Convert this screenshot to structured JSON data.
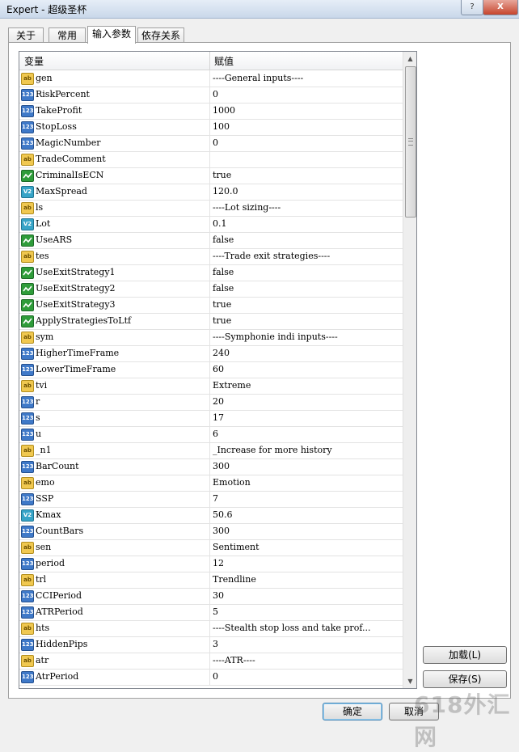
{
  "window": {
    "title": "Expert - 超级圣杯",
    "help_label": "?",
    "close_label": "X"
  },
  "tabs": [
    {
      "label": "关于"
    },
    {
      "label": "常用"
    },
    {
      "label": "输入参数"
    },
    {
      "label": "依存关系"
    }
  ],
  "grid": {
    "col_variable": "变量",
    "col_value": "赋值",
    "rows": [
      {
        "type": "string",
        "name": "gen",
        "value": "----General inputs----"
      },
      {
        "type": "int",
        "name": "RiskPercent",
        "value": "0"
      },
      {
        "type": "int",
        "name": "TakeProfit",
        "value": "1000"
      },
      {
        "type": "int",
        "name": "StopLoss",
        "value": "100"
      },
      {
        "type": "int",
        "name": "MagicNumber",
        "value": "0"
      },
      {
        "type": "string",
        "name": "TradeComment",
        "value": ""
      },
      {
        "type": "bool",
        "name": "CriminalIsECN",
        "value": "true"
      },
      {
        "type": "double",
        "name": "MaxSpread",
        "value": "120.0"
      },
      {
        "type": "string",
        "name": "ls",
        "value": "----Lot sizing----"
      },
      {
        "type": "double",
        "name": "Lot",
        "value": "0.1"
      },
      {
        "type": "bool",
        "name": "UseARS",
        "value": "false"
      },
      {
        "type": "string",
        "name": "tes",
        "value": "----Trade exit strategies----"
      },
      {
        "type": "bool",
        "name": "UseExitStrategy1",
        "value": "false"
      },
      {
        "type": "bool",
        "name": "UseExitStrategy2",
        "value": "false"
      },
      {
        "type": "bool",
        "name": "UseExitStrategy3",
        "value": "true"
      },
      {
        "type": "bool",
        "name": "ApplyStrategiesToLtf",
        "value": "true"
      },
      {
        "type": "string",
        "name": "sym",
        "value": "----Symphonie indi inputs----"
      },
      {
        "type": "int",
        "name": "HigherTimeFrame",
        "value": "240"
      },
      {
        "type": "int",
        "name": "LowerTimeFrame",
        "value": "60"
      },
      {
        "type": "string",
        "name": "tvi",
        "value": "Extreme"
      },
      {
        "type": "int",
        "name": "r",
        "value": "20"
      },
      {
        "type": "int",
        "name": "s",
        "value": "17"
      },
      {
        "type": "int",
        "name": "u",
        "value": "6"
      },
      {
        "type": "string",
        "name": "_n1",
        "value": "_Increase for more history"
      },
      {
        "type": "int",
        "name": "BarCount",
        "value": "300"
      },
      {
        "type": "string",
        "name": "emo",
        "value": "Emotion"
      },
      {
        "type": "int",
        "name": "SSP",
        "value": "7"
      },
      {
        "type": "double",
        "name": "Kmax",
        "value": "50.6"
      },
      {
        "type": "int",
        "name": "CountBars",
        "value": "300"
      },
      {
        "type": "string",
        "name": "sen",
        "value": "Sentiment"
      },
      {
        "type": "int",
        "name": "period",
        "value": "12"
      },
      {
        "type": "string",
        "name": "trl",
        "value": "Trendline"
      },
      {
        "type": "int",
        "name": "CCIPeriod",
        "value": "30"
      },
      {
        "type": "int",
        "name": "ATRPeriod",
        "value": "5"
      },
      {
        "type": "string",
        "name": "hts",
        "value": "----Stealth stop loss and take prof..."
      },
      {
        "type": "int",
        "name": "HiddenPips",
        "value": "3"
      },
      {
        "type": "string",
        "name": "atr",
        "value": "----ATR----"
      },
      {
        "type": "int",
        "name": "AtrPeriod",
        "value": "0"
      }
    ]
  },
  "icons": {
    "string": "ab",
    "int": "123",
    "bool": "",
    "double": "V2"
  },
  "buttons": {
    "load": "加载(L)",
    "save": "保存(S)",
    "ok": "确定",
    "cancel": "取消"
  },
  "watermark": "618外汇网"
}
